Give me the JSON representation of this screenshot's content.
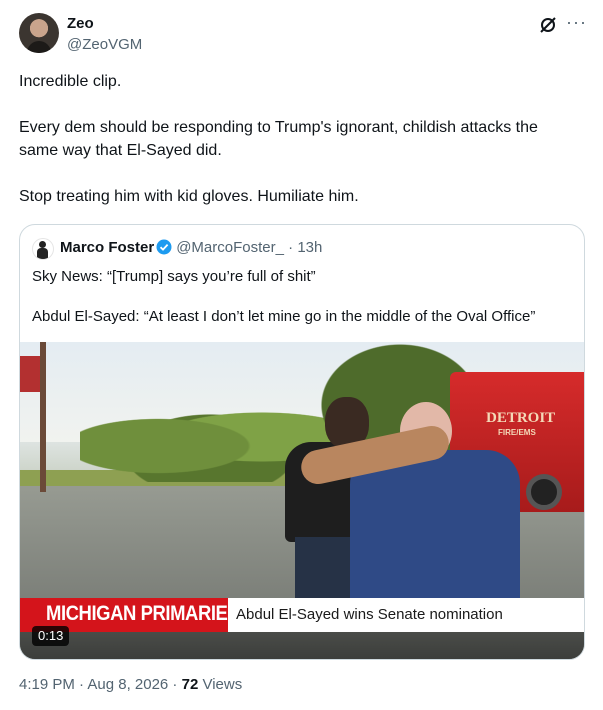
{
  "author": {
    "name": "Zeo",
    "handle": "@ZeoVGM"
  },
  "tweet": {
    "paragraphs": [
      "Incredible clip.",
      "Every dem should be responding to Trump's ignorant, childish attacks the same way that El-Sayed did.",
      "Stop treating him with kid gloves. Humiliate him."
    ]
  },
  "quoted": {
    "name": "Marco Foster",
    "handle": "@MarcoFoster_",
    "separator": " · ",
    "time": "13h",
    "verified_color": "#1d9bf0",
    "paragraphs": [
      "Sky News: “[Trump] says you’re full of shit”",
      "Abdul El-Sayed: “At least I don’t let mine go in the middle of the Oval Office”"
    ],
    "video": {
      "truck_text": "DETROIT",
      "truck_subtext": "FIRE/EMS",
      "chyron_tag": "MICHIGAN PRIMARIES",
      "chyron_headline": "Abdul El-Sayed wins Senate nomination",
      "duration": "0:13",
      "chyron_color": "#d4141b"
    }
  },
  "meta": {
    "time_date": "4:19 PM · Aug 8, 2026 · ",
    "views_count": "72",
    "views_label": " Views"
  },
  "icons": {
    "grok": "grok-icon",
    "more": "more-options-icon",
    "verified": "verified-badge-icon"
  }
}
